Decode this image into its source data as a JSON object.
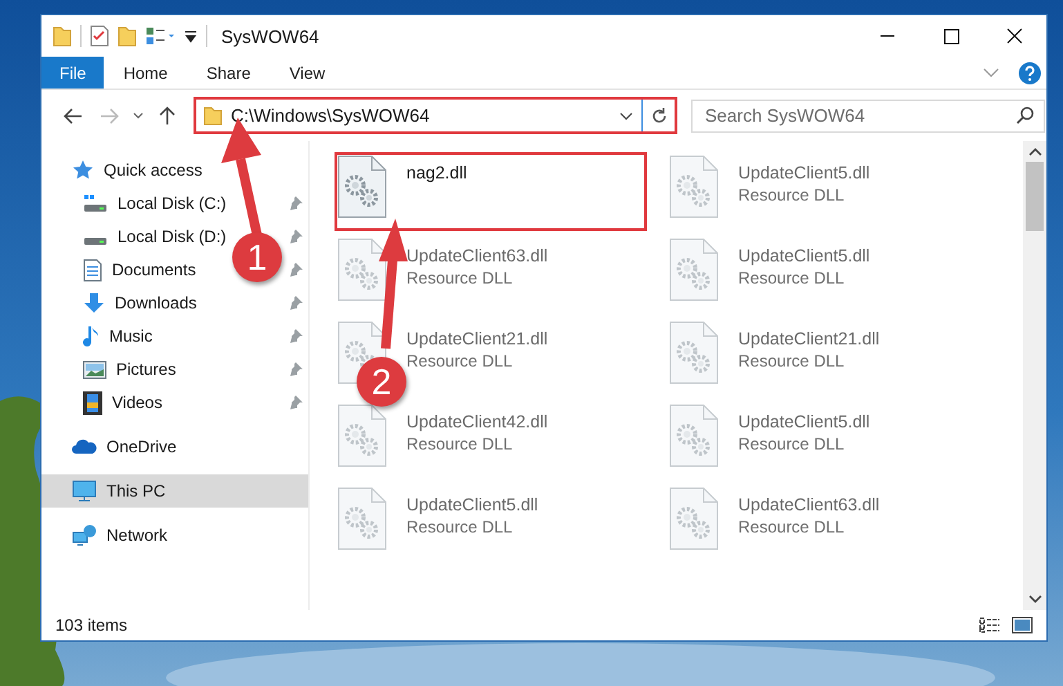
{
  "window": {
    "title": "SysWOW64"
  },
  "ribbon_tabs": [
    {
      "label": "File",
      "kind": "menu",
      "selected": false
    },
    {
      "label": "Home",
      "kind": "tab",
      "selected": false
    },
    {
      "label": "Share",
      "kind": "tab",
      "selected": false
    },
    {
      "label": "View",
      "kind": "tab",
      "selected": false
    }
  ],
  "address_bar": {
    "path": "C:\\Windows\\SysWOW64",
    "highlighted": true
  },
  "search": {
    "placeholder": "Search SysWOW64"
  },
  "navigation": [
    {
      "label": "Quick access",
      "selected": false,
      "children": [
        {
          "label": "Local Disk (C:)",
          "pinned": true,
          "selected": false
        },
        {
          "label": "Local Disk (D:)",
          "pinned": true,
          "selected": false
        },
        {
          "label": "Documents",
          "pinned": true,
          "selected": false
        },
        {
          "label": "Downloads",
          "pinned": true,
          "selected": false
        },
        {
          "label": "Music",
          "pinned": true,
          "selected": false
        },
        {
          "label": "Pictures",
          "pinned": true,
          "selected": false
        },
        {
          "label": "Videos",
          "pinned": true,
          "selected": false
        }
      ]
    },
    {
      "label": "OneDrive",
      "selected": false
    },
    {
      "label": "This PC",
      "selected": true
    },
    {
      "label": "Network",
      "selected": false
    }
  ],
  "files": [
    {
      "name": "nag2.dll",
      "blurred": false,
      "highlighted": true
    },
    {
      "name": "UpdateClient5.dll",
      "type": "Resource DLL",
      "blurred": true,
      "highlighted": false
    },
    {
      "name": "UpdateClient63.dll",
      "type": "Resource DLL",
      "blurred": true,
      "highlighted": false
    },
    {
      "name": "UpdateClient5.dll",
      "type": "Resource DLL",
      "blurred": true,
      "highlighted": false
    },
    {
      "name": "UpdateClient21.dll",
      "type": "Resource DLL",
      "blurred": true,
      "highlighted": false
    },
    {
      "name": "UpdateClient21.dll",
      "type": "Resource DLL",
      "blurred": true,
      "highlighted": false
    },
    {
      "name": "UpdateClient42.dll",
      "type": "Resource DLL",
      "blurred": true,
      "highlighted": false
    },
    {
      "name": "UpdateClient5.dll",
      "type": "Resource DLL",
      "blurred": true,
      "highlighted": false
    },
    {
      "name": "UpdateClient5.dll",
      "type": "Resource DLL",
      "blurred": true,
      "highlighted": false
    },
    {
      "name": "UpdateClient63.dll",
      "type": "Resource DLL",
      "blurred": true,
      "highlighted": false
    }
  ],
  "status_bar": {
    "item_count": "103 items"
  },
  "callouts": [
    {
      "number": "1"
    },
    {
      "number": "2"
    }
  ]
}
